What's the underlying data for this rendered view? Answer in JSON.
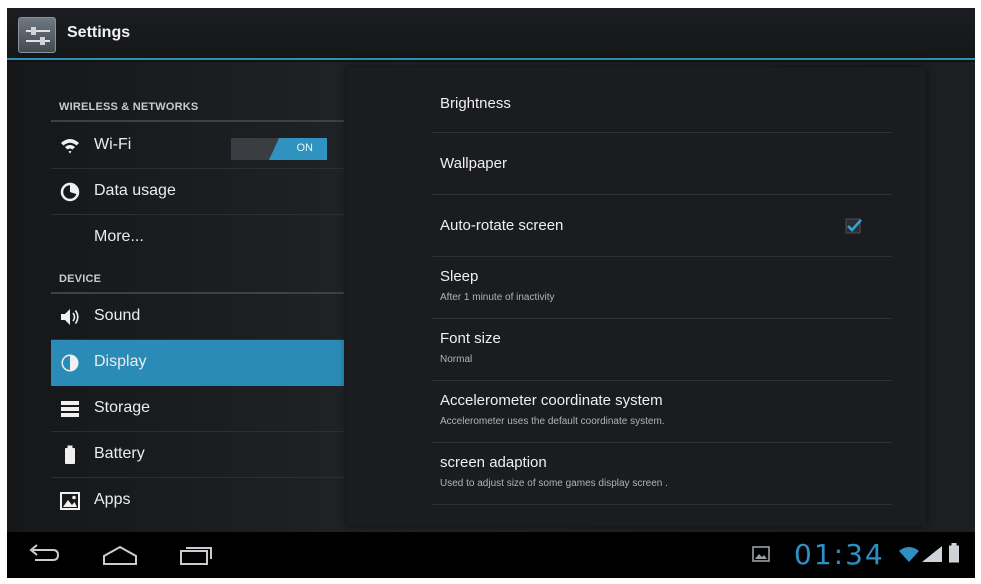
{
  "app": {
    "title": "Settings",
    "icon": "settings-app-icon"
  },
  "sidebar": {
    "sections": [
      {
        "header": "WIRELESS & NETWORKS"
      },
      {
        "header": "DEVICE"
      }
    ],
    "items": [
      {
        "label": "Wi-Fi",
        "icon": "wifi-icon",
        "toggle": "ON"
      },
      {
        "label": "Data usage",
        "icon": "data-usage-icon"
      },
      {
        "label": "More...",
        "icon": ""
      },
      {
        "label": "Sound",
        "icon": "speaker-icon"
      },
      {
        "label": "Display",
        "icon": "display-icon",
        "selected": true
      },
      {
        "label": "Storage",
        "icon": "storage-icon"
      },
      {
        "label": "Battery",
        "icon": "battery-icon"
      },
      {
        "label": "Apps",
        "icon": "apps-icon"
      }
    ]
  },
  "display_settings": [
    {
      "title": "Brightness",
      "summary": ""
    },
    {
      "title": "Wallpaper",
      "summary": ""
    },
    {
      "title": "Auto-rotate screen",
      "summary": "",
      "checked": true
    },
    {
      "title": "Sleep",
      "summary": "After 1 minute of inactivity"
    },
    {
      "title": "Font size",
      "summary": "Normal"
    },
    {
      "title": "Accelerometer coordinate system",
      "summary": "Accelerometer uses the default coordinate system."
    },
    {
      "title": "screen adaption",
      "summary": "Used to adjust size of some games display screen ."
    }
  ],
  "status_bar": {
    "time": "01:34"
  },
  "colors": {
    "accent": "#2a8bb7",
    "background": "#1a1c1f",
    "clock": "#2f8fc4"
  }
}
